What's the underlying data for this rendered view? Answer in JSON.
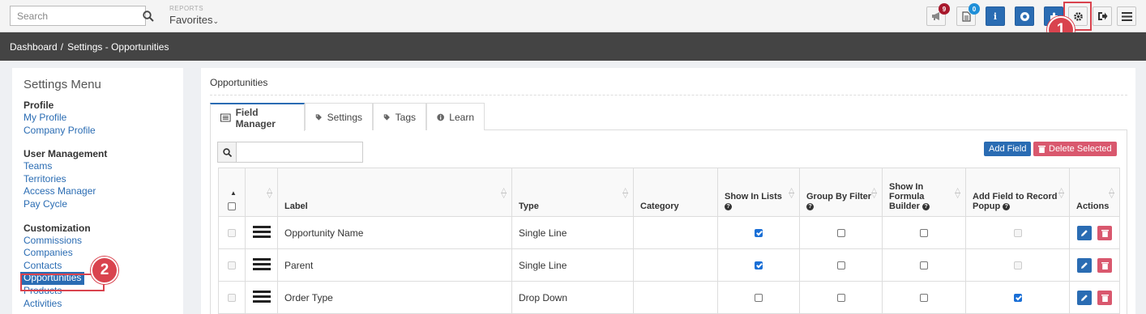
{
  "topbar": {
    "search_placeholder": "Search",
    "reports_label": "REPORTS",
    "favorites_label": "Favorites",
    "notifications_count": "9",
    "documents_count": "0"
  },
  "callouts": {
    "one": "1",
    "two": "2"
  },
  "breadcrumb": {
    "home": "Dashboard",
    "separator": "/",
    "current": "Settings - Opportunities"
  },
  "sidebar": {
    "title": "Settings Menu",
    "sections": [
      {
        "title": "Profile",
        "items": [
          "My Profile",
          "Company Profile"
        ]
      },
      {
        "title": "User Management",
        "items": [
          "Teams",
          "Territories",
          "Access Manager",
          "Pay Cycle"
        ]
      },
      {
        "title": "Customization",
        "items": [
          "Commissions",
          "Companies",
          "Contacts",
          "Opportunities",
          "Products",
          "Activities"
        ]
      }
    ]
  },
  "main": {
    "title": "Opportunities",
    "tabs": [
      "Field Manager",
      "Settings",
      "Tags",
      "Learn"
    ],
    "add_field": "Add Field",
    "delete_selected": "Delete Selected",
    "columns": {
      "label": "Label",
      "type": "Type",
      "category": "Category",
      "show_in_lists": "Show In Lists",
      "group_by_filter": "Group By Filter",
      "formula_builder_1": "Show In",
      "formula_builder_2": "Formula",
      "formula_builder_3": "Builder",
      "popup_1": "Add Field to Record",
      "popup_2": "Popup",
      "actions": "Actions"
    },
    "rows": [
      {
        "label": "Opportunity Name",
        "type": "Single Line",
        "category": "",
        "show_in_lists": true,
        "group_by": false,
        "formula": false,
        "popup": "disabled"
      },
      {
        "label": "Parent",
        "type": "Single Line",
        "category": "",
        "show_in_lists": true,
        "group_by": false,
        "formula": false,
        "popup": "disabled"
      },
      {
        "label": "Order Type",
        "type": "Drop Down",
        "category": "",
        "show_in_lists": false,
        "group_by": false,
        "formula": false,
        "popup": "checked"
      }
    ]
  },
  "colors": {
    "accent": "#2a6cb3",
    "danger": "#d9586e",
    "callout": "#d9434e",
    "header_dark": "#444444"
  }
}
